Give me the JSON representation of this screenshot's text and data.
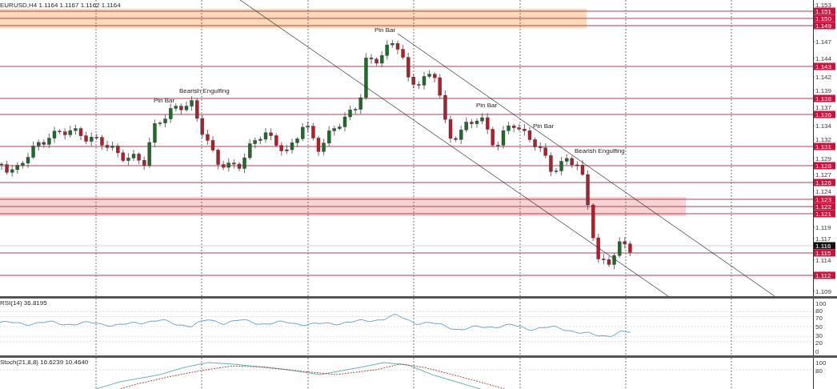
{
  "chart": {
    "title": "EURUSD,H4 1.1164 1.1167 1.1162 1.1164",
    "price_axis": [
      {
        "label": "1.153",
        "kind": "tick"
      },
      {
        "label": "1.151",
        "kind": "level"
      },
      {
        "label": "1.150",
        "kind": "level"
      },
      {
        "label": "1.149",
        "kind": "level"
      },
      {
        "label": "1.147",
        "kind": "tick"
      },
      {
        "label": "1.144",
        "kind": "tick"
      },
      {
        "label": "1.143",
        "kind": "level"
      },
      {
        "label": "1.142",
        "kind": "tick"
      },
      {
        "label": "1.139",
        "kind": "tick"
      },
      {
        "label": "1.138",
        "kind": "level"
      },
      {
        "label": "1.137",
        "kind": "tick"
      },
      {
        "label": "1.136",
        "kind": "level"
      },
      {
        "label": "1.134",
        "kind": "tick"
      },
      {
        "label": "1.132",
        "kind": "tick"
      },
      {
        "label": "1.131",
        "kind": "level"
      },
      {
        "label": "1.129",
        "kind": "tick"
      },
      {
        "label": "1.128",
        "kind": "level"
      },
      {
        "label": "1.127",
        "kind": "tick"
      },
      {
        "label": "1.126",
        "kind": "level"
      },
      {
        "label": "1.124",
        "kind": "tick"
      },
      {
        "label": "1.123",
        "kind": "level"
      },
      {
        "label": "1.122",
        "kind": "level"
      },
      {
        "label": "1.121",
        "kind": "level"
      },
      {
        "label": "1.119",
        "kind": "tick"
      },
      {
        "label": "1.117",
        "kind": "tick"
      },
      {
        "label": "1.116",
        "kind": "current"
      },
      {
        "label": "1.115",
        "kind": "level"
      },
      {
        "label": "1.114",
        "kind": "tick"
      },
      {
        "label": "1.112",
        "kind": "level"
      },
      {
        "label": "1.109",
        "kind": "tick"
      }
    ],
    "annotations": [
      "Pin Bar",
      "Bearish Engulfing",
      "Pin Bar",
      "Pin Bar",
      "Pin Bar",
      "Bearish Engulfing"
    ]
  },
  "rsi": {
    "title": "RSI(14) 36.8195",
    "scale": [
      "100",
      "80",
      "70",
      "50",
      "30",
      "20",
      "0"
    ]
  },
  "stochastic": {
    "title": "Stoch(21,8,8) 16.6239 10.4640",
    "scale": [
      "100",
      "80"
    ]
  }
}
